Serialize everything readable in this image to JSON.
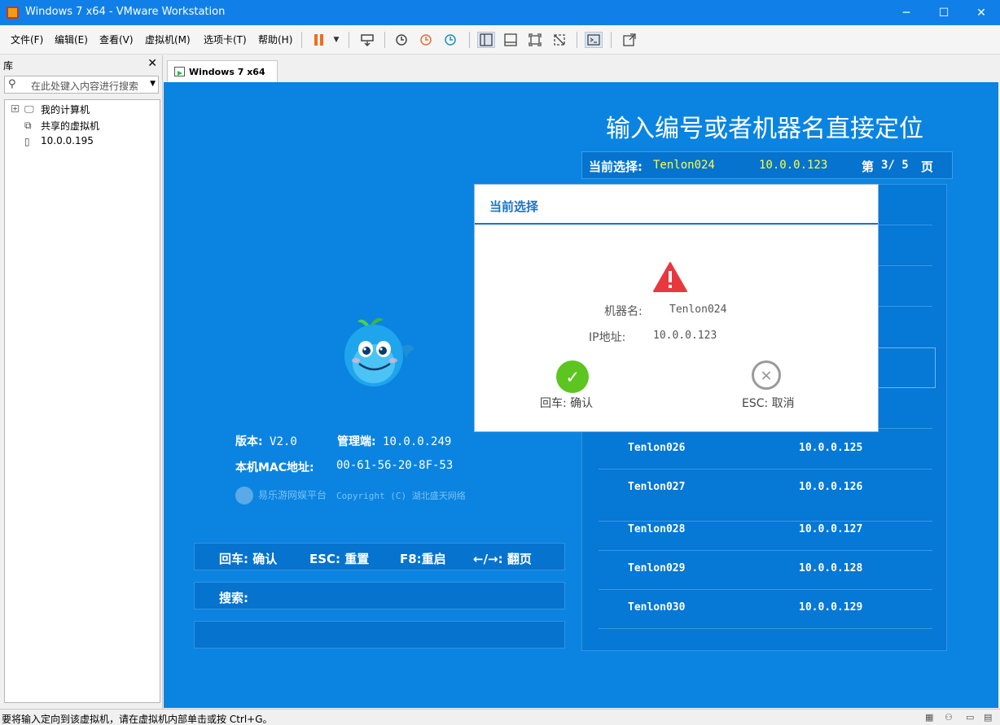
{
  "window": {
    "title": "Windows 7 x64 - VMware Workstation",
    "minimize": "─",
    "maximize": "☐",
    "close": "✕"
  },
  "menu": [
    "文件(F)",
    "编辑(E)",
    "查看(V)",
    "虚拟机(M)",
    "选项卡(T)",
    "帮助(H)"
  ],
  "library": {
    "header": "库",
    "close": "✕",
    "search_placeholder": "在此处键入内容进行搜索",
    "tree": [
      {
        "label": "我的计算机",
        "icon": "computer-icon",
        "expandable": true
      },
      {
        "label": "共享的虚拟机",
        "icon": "shared-vm-icon",
        "expandable": false
      },
      {
        "label": "10.0.0.195",
        "icon": "server-icon",
        "expandable": false
      }
    ]
  },
  "tab": {
    "label": "Windows 7 x64"
  },
  "guest": {
    "title": "输入编号或者机器名直接定位",
    "current": {
      "label": "当前选择:",
      "name": "Tenlon024",
      "ip": "10.0.0.123",
      "page_prefix": "第",
      "page": "3/ 5",
      "page_suffix": "页"
    },
    "rows": [
      {
        "name": "Tenlon026",
        "ip": "10.0.0.125"
      },
      {
        "name": "Tenlon027",
        "ip": "10.0.0.126"
      },
      {
        "name": "Tenlon028",
        "ip": "10.0.0.127"
      },
      {
        "name": "Tenlon029",
        "ip": "10.0.0.128"
      },
      {
        "name": "Tenlon030",
        "ip": "10.0.0.129"
      }
    ],
    "version_label": "版本:",
    "version": "V2.0",
    "server_label": "管理端:",
    "server": "10.0.0.249",
    "mac_label": "本机MAC地址:",
    "mac": "00-61-56-20-8F-53",
    "brand": "易乐游网娱平台",
    "copyright": "Copyright (C) 湖北盛天网络",
    "hints": {
      "enter": "回车: 确认",
      "esc": "ESC: 重置",
      "f8": "F8:重启",
      "page": "←/→: 翻页"
    },
    "search_label": "搜索:"
  },
  "dialog": {
    "title": "当前选择",
    "machine_label": "机器名:",
    "machine": "Tenlon024",
    "ip_label": "IP地址:",
    "ip": "10.0.0.123",
    "confirm": "回车: 确认",
    "cancel": "ESC: 取消"
  },
  "status": {
    "text": "要将输入定向到该虚拟机，请在虚拟机内部单击或按 Ctrl+G。"
  },
  "colors": {
    "titlebar": "#1080e8",
    "guest_bg": "#0a84e0",
    "highlight": "#ffff3c",
    "dialog_accent": "#1a73c8",
    "ok": "#5cc520"
  }
}
